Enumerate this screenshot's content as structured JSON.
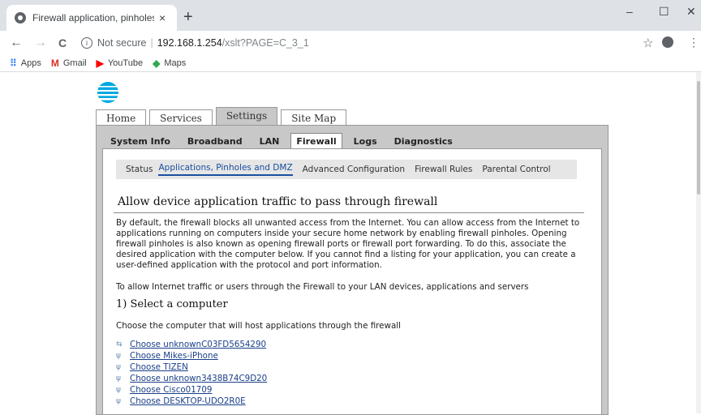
{
  "browser": {
    "tab_title": "Firewall application, pinholes and",
    "tab_close": "×",
    "new_tab": "+",
    "minimize": "–",
    "maximize": "☐",
    "close": "✕",
    "back": "←",
    "forward": "→",
    "reload": "C",
    "security_info": "i",
    "not_secure": "Not secure",
    "separator": "|",
    "host": "192.168.1.254",
    "path": "/xslt?PAGE=C_3_1",
    "star": "☆",
    "menu": "⋮",
    "bookmarks": [
      {
        "icon": "apps-icon",
        "glyph": "⠿",
        "color": "#4285f4",
        "label": "Apps"
      },
      {
        "icon": "gmail-icon",
        "glyph": "M",
        "color": "#d93025",
        "label": "Gmail"
      },
      {
        "icon": "youtube-icon",
        "glyph": "▶",
        "color": "#ff0000",
        "label": "YouTube"
      },
      {
        "icon": "maps-icon",
        "glyph": "◆",
        "color": "#34a853",
        "label": "Maps"
      }
    ]
  },
  "router": {
    "top_tabs": [
      "Home",
      "Services",
      "Settings",
      "Site Map"
    ],
    "active_top_tab": "Settings",
    "sub_tabs": [
      "System Info",
      "Broadband",
      "LAN",
      "Firewall",
      "Logs",
      "Diagnostics"
    ],
    "active_sub_tab": "Firewall",
    "subnav": [
      "Status",
      "Applications, Pinholes and DMZ",
      "Advanced Configuration",
      "Firewall Rules",
      "Parental Control"
    ],
    "heading": "Allow device application traffic to pass through firewall",
    "paragraph": "By default, the firewall blocks all unwanted access from the Internet. You can allow access from the Internet to applications running on computers inside your secure home network by enabling firewall pinholes. Opening firewall pinholes is also known as opening firewall ports or firewall port forwarding. To do this, associate the desired application with the computer below. If you cannot find a listing for your application, you can create a user-defined application with the protocol and port information.",
    "paragraph2": "To allow Internet traffic or users through the Firewall to your LAN devices, applications and servers",
    "section_title": "1) Select a computer",
    "section_desc": "Choose the computer that will host applications through the firewall",
    "devices": [
      {
        "icon": "wired-device-icon",
        "glyph": "⇆",
        "label": "Choose unknownC03FD5654290"
      },
      {
        "icon": "wifi-device-icon",
        "glyph": "ψ",
        "label": "Choose Mikes-iPhone"
      },
      {
        "icon": "wifi-device-icon",
        "glyph": "ψ",
        "label": "Choose TIZEN"
      },
      {
        "icon": "wifi-device-icon",
        "glyph": "ψ",
        "label": "Choose unknown3438B74C9D20"
      },
      {
        "icon": "wifi-device-icon",
        "glyph": "ψ",
        "label": "Choose Cisco01709"
      },
      {
        "icon": "wifi-device-icon",
        "glyph": "ψ",
        "label": "Choose DESKTOP-UDO2R0E"
      }
    ]
  },
  "colors": {
    "accent": "#1a4ea0",
    "link": "#1a3f8a",
    "panel": "#c8c8c8",
    "att_blue": "#00a8e0"
  }
}
